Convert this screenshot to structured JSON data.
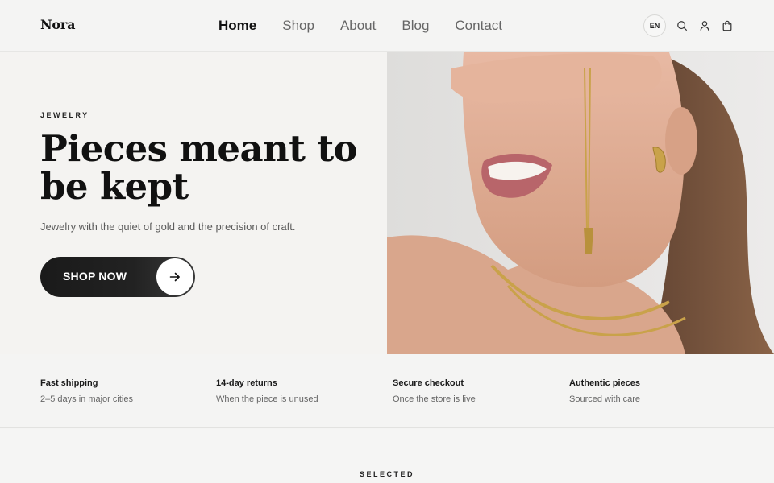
{
  "brand": {
    "name": "Nora"
  },
  "nav": [
    {
      "label": "Home",
      "active": true
    },
    {
      "label": "Shop",
      "active": false
    },
    {
      "label": "About",
      "active": false
    },
    {
      "label": "Blog",
      "active": false
    },
    {
      "label": "Contact",
      "active": false
    }
  ],
  "header_actions": {
    "language": "EN",
    "icons": [
      "search-icon",
      "user-icon",
      "cart-icon"
    ]
  },
  "hero": {
    "eyebrow": "JEWELRY",
    "title": "Pieces meant to be kept",
    "subtitle": "Jewelry with the quiet of gold and the precision of craft.",
    "cta_label": "SHOP NOW",
    "cta_icon": "arrow-right-icon",
    "image": "model-with-gold-necklace-photo"
  },
  "features": [
    {
      "title": "Fast shipping",
      "desc": "2–5 days in major cities"
    },
    {
      "title": "14-day returns",
      "desc": "When the piece is unused"
    },
    {
      "title": "Secure checkout",
      "desc": "Once the store is live"
    },
    {
      "title": "Authentic pieces",
      "desc": "Sourced with care"
    }
  ],
  "section": {
    "label": "SELECTED"
  },
  "colors": {
    "background": "#f4f4f3",
    "text": "#1b1b1b",
    "button": "#1a1a1a",
    "gold": "#c9a24a"
  }
}
